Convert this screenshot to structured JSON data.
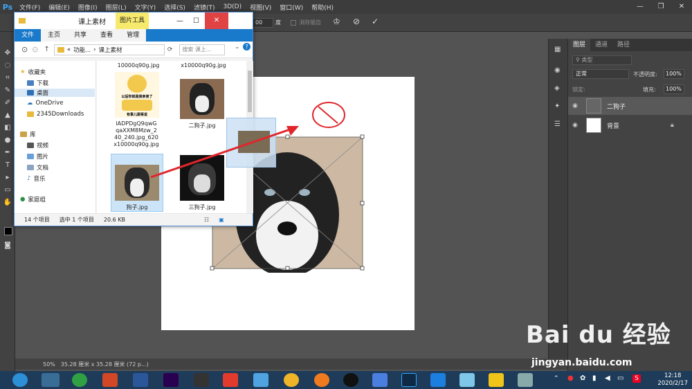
{
  "ps": {
    "logo": "Ps",
    "menus": [
      "文件(F)",
      "编辑(E)",
      "图像(I)",
      "图层(L)",
      "文字(Y)",
      "选择(S)",
      "滤镜(T)",
      "3D(D)",
      "视图(V)",
      "窗口(W)",
      "帮助(H)"
    ],
    "options": {
      "angle_value": "00",
      "angle_unit": "度",
      "interp_label": "消除锯齿"
    }
  },
  "explorer": {
    "title": "课上素材",
    "tool_tab": "图片工具",
    "tabs": [
      "文件",
      "主页",
      "共享",
      "查看",
      "管理"
    ],
    "breadcrumb": [
      "«",
      "功能...",
      "›",
      "课上素材"
    ],
    "search_placeholder": "搜索 课上...",
    "nav": {
      "favorites": "收藏夹",
      "downloads": "下载",
      "desktop": "桌面",
      "onedrive": "OneDrive",
      "downloads2345": "2345Downloads",
      "library": "库",
      "videos": "视频",
      "pictures": "图片",
      "documents": "文档",
      "music": "音乐",
      "homegroup": "家庭组"
    },
    "files": {
      "top_left": "10000q90g.jpg",
      "top_right": "x10000q90g.jpg",
      "meme_name": "lADPDgQ9qwGqaXXM8Mzw_240_240.jpg_620x10000q90g.jpg",
      "meme_name_l1": "lADPDgQ9qwG",
      "meme_name_l2": "qaXXM8Mzw_2",
      "meme_name_l3": "40_240.jpg_620",
      "meme_name_l4": "x10000q90g.jpg",
      "meme_caption_top": "以后你就是我亲弟了",
      "meme_caption_bottom": "有事儿跟哥说",
      "dog2": "二狗子.jpg",
      "dog1": "狗子.jpg",
      "dog3": "三狗子.jpg"
    },
    "status": {
      "count": "14 个项目",
      "selected": "选中 1 个项目",
      "size": "20.6 KB"
    }
  },
  "layers": {
    "tabs": [
      "图层",
      "通道",
      "路径"
    ],
    "filter": "类型",
    "blend": "正常",
    "opacity_label": "不透明度:",
    "opacity_value": "100%",
    "lock_label": "锁定:",
    "fill_label": "填充:",
    "fill_value": "100%",
    "items": [
      {
        "name": "二狗子"
      },
      {
        "name": "背景"
      }
    ]
  },
  "status_bar": {
    "zoom": "50%",
    "doc": "35.28 厘米 x 35.28 厘米 (72 p...)"
  },
  "watermark": {
    "brand": "Bai du 经验",
    "url": "jingyan.baidu.com"
  },
  "taskbar": {
    "time": "12:18",
    "date": "2020/2/17",
    "ime": "S"
  },
  "colors": {
    "ps_bg": "#535353",
    "accent_blue": "#1979ca",
    "arrow_red": "#e0262b"
  }
}
